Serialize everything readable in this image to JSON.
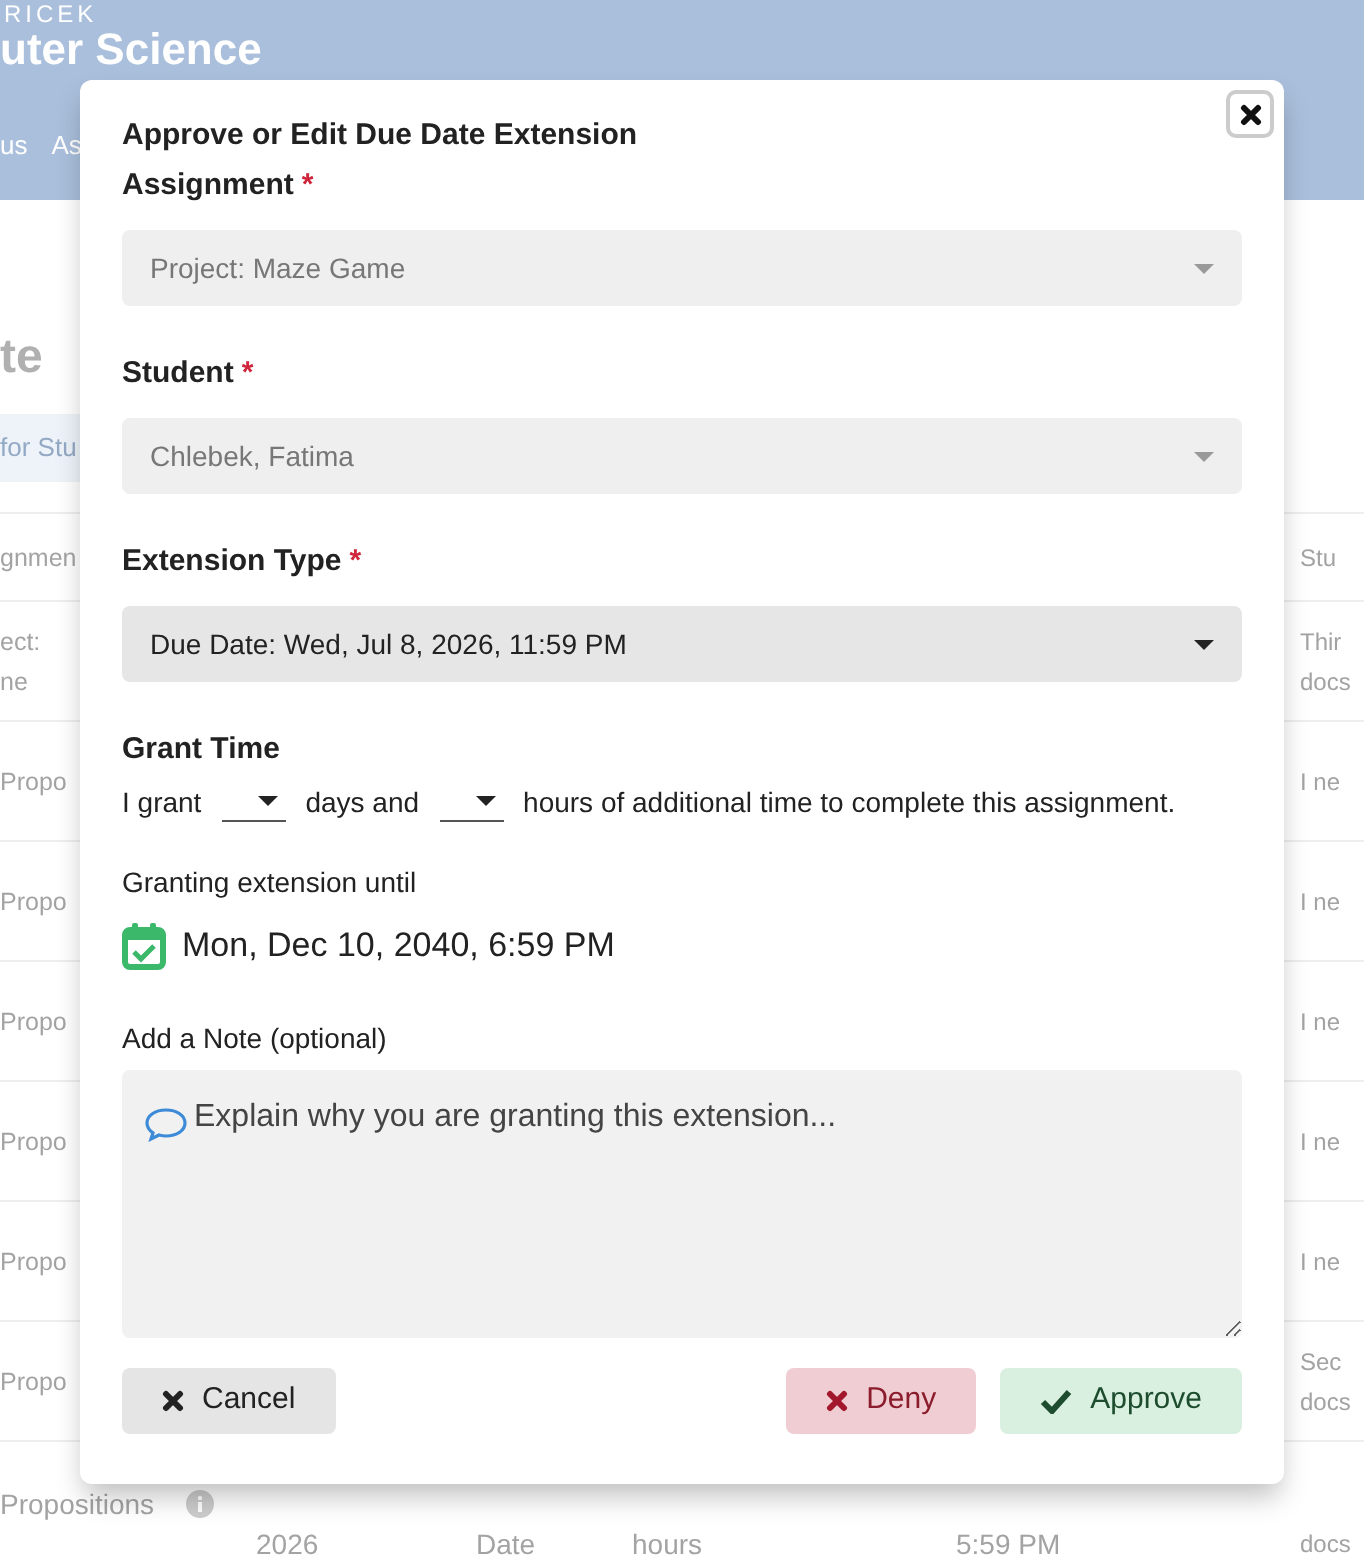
{
  "background": {
    "header": {
      "school": "RICEK",
      "course": "uter Science",
      "nav": [
        "us",
        "As"
      ]
    },
    "page_title": "te",
    "search": {
      "placeholder": "for Stu"
    },
    "table": {
      "columns": [
        "gnmen",
        "Stu"
      ],
      "rows": [
        {
          "kind": "partial",
          "left": "ect:\nne",
          "right": "Thir\ndocs"
        },
        {
          "kind": "partial",
          "left": "Propo",
          "right": "I ne"
        },
        {
          "kind": "partial",
          "left": "Propo",
          "right": "I ne"
        },
        {
          "kind": "partial",
          "left": "Propo",
          "right": "I ne"
        },
        {
          "kind": "partial",
          "left": "Propo",
          "right": "I ne"
        },
        {
          "kind": "partial",
          "left": "Propo",
          "right": "I ne"
        },
        {
          "kind": "partial",
          "left": "Propo",
          "right": "Sec\ndocs"
        },
        {
          "kind": "full",
          "cells": [
            "Propositions",
            "2026",
            "Date",
            "hours",
            "5:59 PM",
            "docs"
          ]
        }
      ]
    }
  },
  "modal": {
    "title": "Approve or Edit Due Date Extension",
    "fields": [
      {
        "label": "Assignment",
        "required_mark": "*",
        "value": "Project: Maze Game",
        "disabled": true
      },
      {
        "label": "Student",
        "required_mark": "*",
        "value": "Chlebek, Fatima",
        "disabled": true
      },
      {
        "label": "Extension Type",
        "required_mark": "*",
        "value": "Due Date: Wed, Jul 8, 2026, 11:59 PM",
        "disabled": false
      }
    ],
    "grant": {
      "label": "Grant Time",
      "parts": [
        "I grant",
        "days and",
        "hours of additional time to complete this assignment."
      ]
    },
    "until": {
      "label": "Granting extension until",
      "value": "Mon, Dec 10, 2040, 6:59 PM"
    },
    "note": {
      "label": "Add a Note (optional)",
      "placeholder": "Explain why you are granting this extension..."
    },
    "buttons": [
      {
        "label": "Cancel",
        "kind": "cancel"
      },
      {
        "label": "Deny",
        "kind": "deny"
      },
      {
        "label": "Approve",
        "kind": "approve"
      }
    ]
  }
}
